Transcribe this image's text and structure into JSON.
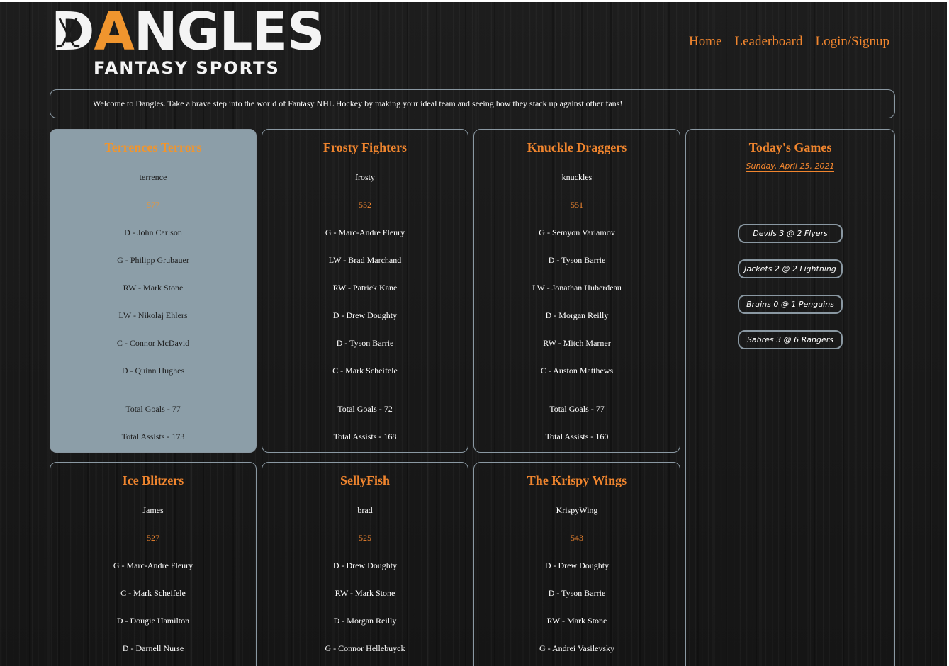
{
  "brand": {
    "main_prefix": "D",
    "main_accent": "A",
    "main_suffix": "NGLES",
    "sub": "FANTASY SPORTS"
  },
  "nav": {
    "home": "Home",
    "leaderboard": "Leaderboard",
    "login": "Login/Signup"
  },
  "welcome": "Welcome to Dangles. Take a brave step into the world of Fantasy NHL Hockey by making your ideal team and seeing how they stack up against other fans!",
  "colors": {
    "accent": "#f0852e",
    "border": "#8a98a2",
    "highlight_card": "#8c9ea8",
    "background": "#1a1a1a"
  },
  "teams": [
    {
      "name": "Terrences Terrors",
      "owner": "terrence",
      "score": "577",
      "players": [
        "D - John Carlson",
        "G - Philipp Grubauer",
        "RW - Mark Stone",
        "LW - Nikolaj Ehlers",
        "C - Connor McDavid",
        "D - Quinn Hughes"
      ],
      "goals": "Total Goals - 77",
      "assists": "Total Assists - 173"
    },
    {
      "name": "Frosty Fighters",
      "owner": "frosty",
      "score": "552",
      "players": [
        "G - Marc-Andre Fleury",
        "LW - Brad Marchand",
        "RW - Patrick Kane",
        "D - Drew Doughty",
        "D - Tyson Barrie",
        "C - Mark Scheifele"
      ],
      "goals": "Total Goals - 72",
      "assists": "Total Assists - 168"
    },
    {
      "name": "Knuckle Draggers",
      "owner": "knuckles",
      "score": "551",
      "players": [
        "G - Semyon Varlamov",
        "D - Tyson Barrie",
        "LW - Jonathan Huberdeau",
        "D - Morgan Reilly",
        "RW - Mitch Marner",
        "C - Auston Matthews"
      ],
      "goals": "Total Goals - 77",
      "assists": "Total Assists - 160"
    },
    {
      "name": "Ice Blitzers",
      "owner": "James",
      "score": "527",
      "players": [
        "G - Marc-Andre Fleury",
        "C - Mark Scheifele",
        "D - Dougie Hamilton",
        "D - Darnell Nurse"
      ]
    },
    {
      "name": "SellyFish",
      "owner": "brad",
      "score": "525",
      "players": [
        "D - Drew Doughty",
        "RW - Mark Stone",
        "D - Morgan Reilly",
        "G - Connor Hellebuyck"
      ]
    },
    {
      "name": "The Krispy Wings",
      "owner": "KrispyWing",
      "score": "543",
      "players": [
        "D - Drew Doughty",
        "D - Tyson Barrie",
        "RW - Mark Stone",
        "G - Andrei Vasilevsky"
      ]
    }
  ],
  "games": {
    "title": "Today's Games",
    "date": "Sunday, April 25, 2021",
    "list": [
      "Devils 3 @ 2 Flyers",
      "Jackets 2 @ 2 Lightning",
      "Bruins 0 @ 1 Penguins",
      "Sabres 3 @ 6 Rangers"
    ]
  }
}
